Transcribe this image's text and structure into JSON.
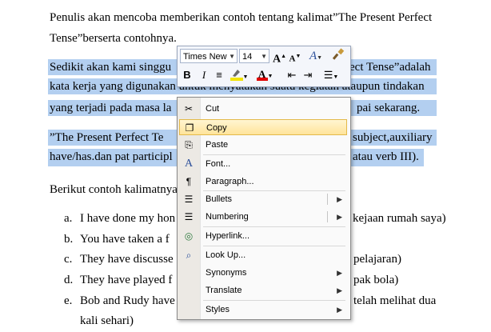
{
  "document": {
    "lines": [
      "Penulis akan mencoba memberikan contoh tentang kalimat”The Present Perfect",
      "Tense”berserta contohnya.",
      "Sedikit akan kami singgu",
      "ect Tense”adalah",
      "kata kerja yang digunakan untuk menyatakan suatu kegiatan ataupun tindakan",
      "yang terjadi pada masa la",
      "pai sekarang.",
      "”The Present Perfect Te",
      "subject,auxiliary",
      "have/has.dan pat participl",
      "atau verb III).",
      "Berikut contoh kalimatnya"
    ],
    "list": [
      {
        "marker": "a.",
        "left": "I have done my hon",
        "right": "kejaan rumah saya)"
      },
      {
        "marker": "b.",
        "left": "You have taken a f",
        "right": ""
      },
      {
        "marker": "c.",
        "left": "They have discusse",
        "right": "pelajaran)"
      },
      {
        "marker": "d.",
        "left": "They have played f",
        "right": "pak bola)"
      },
      {
        "marker": "e.",
        "left": "Bob and Rudy have",
        "right": "telah melihat dua"
      }
    ],
    "list_continuation": "kali sehari)"
  },
  "mini_toolbar": {
    "font_name": "Times New",
    "font_size": "14",
    "grow_font": "A",
    "shrink_font": "A",
    "styles": "A",
    "bold": "B",
    "italic": "I",
    "font_color": "A",
    "highlight_color": "#f2e400",
    "font_color_value": "#e00000"
  },
  "context_menu": {
    "items": [
      {
        "label": "Cut",
        "icon": "cut-icon",
        "glyph": "✂"
      },
      {
        "label": "Copy",
        "icon": "copy-icon",
        "glyph": "❐",
        "highlighted": true
      },
      {
        "label": "Paste",
        "icon": "paste-icon",
        "glyph": "⎘"
      },
      {
        "label": "Font...",
        "icon": "font-icon",
        "glyph": "A"
      },
      {
        "label": "Paragraph...",
        "icon": "paragraph-icon",
        "glyph": "¶"
      },
      {
        "label": "Bullets",
        "icon": "bullets-icon",
        "glyph": "☰"
      },
      {
        "label": "Numbering",
        "icon": "numbering-icon",
        "glyph": "☰"
      },
      {
        "label": "Hyperlink...",
        "icon": "hyperlink-icon",
        "glyph": "◎"
      },
      {
        "label": "Look Up...",
        "icon": "lookup-icon",
        "glyph": "⌕"
      },
      {
        "label": "Synonyms",
        "icon": "",
        "glyph": ""
      },
      {
        "label": "Translate",
        "icon": "",
        "glyph": ""
      },
      {
        "label": "Styles",
        "icon": "",
        "glyph": ""
      }
    ]
  },
  "colors": {
    "selection": "#b3cff0",
    "menu_highlight": "#ffe49a"
  }
}
